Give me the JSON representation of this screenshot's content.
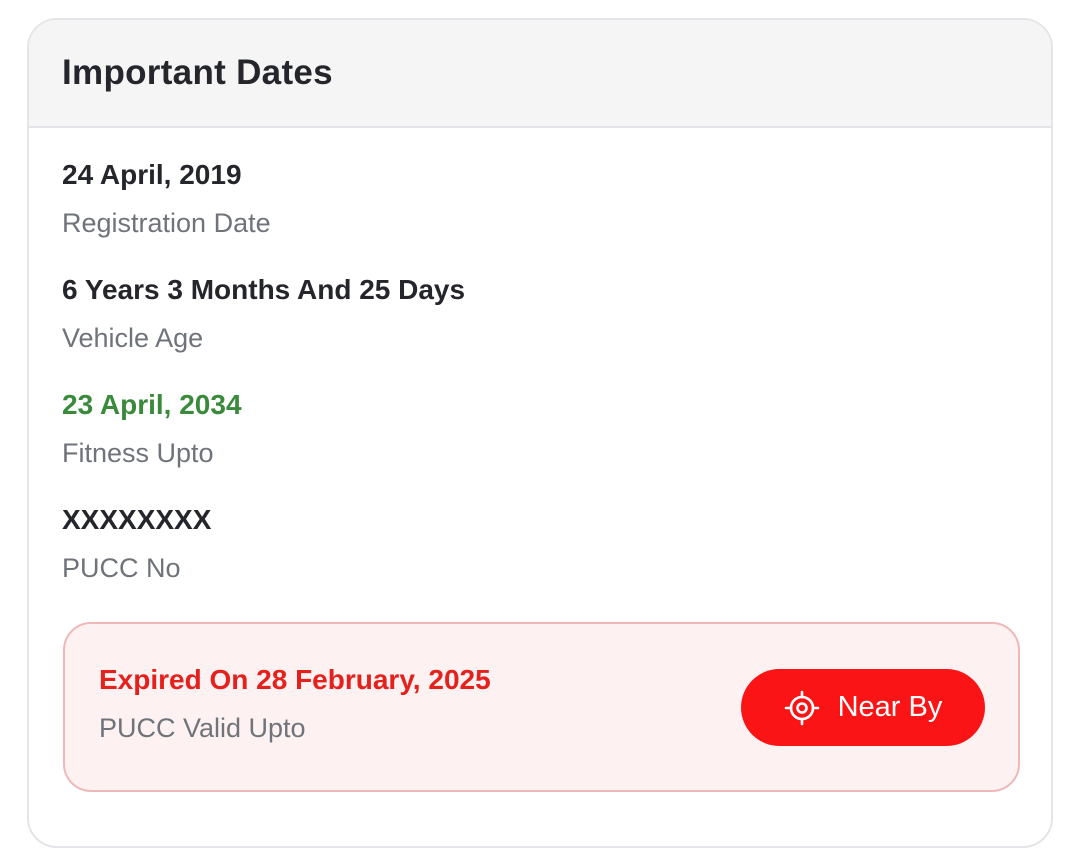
{
  "card": {
    "title": "Important Dates"
  },
  "items": [
    {
      "value": "24 April, 2019",
      "label": "Registration Date"
    },
    {
      "value": "6 Years 3 Months And 25 Days",
      "label": "Vehicle Age"
    },
    {
      "value": "23 April, 2034",
      "label": "Fitness Upto",
      "value_color": "#3a8a3c"
    },
    {
      "value": "XXXXXXXX",
      "label": "PUCC No"
    }
  ],
  "pucc_alert": {
    "value": "Expired On 28 February, 2025",
    "label": "PUCC Valid Upto",
    "value_color": "#e5211d",
    "button": {
      "label": "Near By",
      "icon": "location-target-icon",
      "color": "#fb1415"
    }
  }
}
